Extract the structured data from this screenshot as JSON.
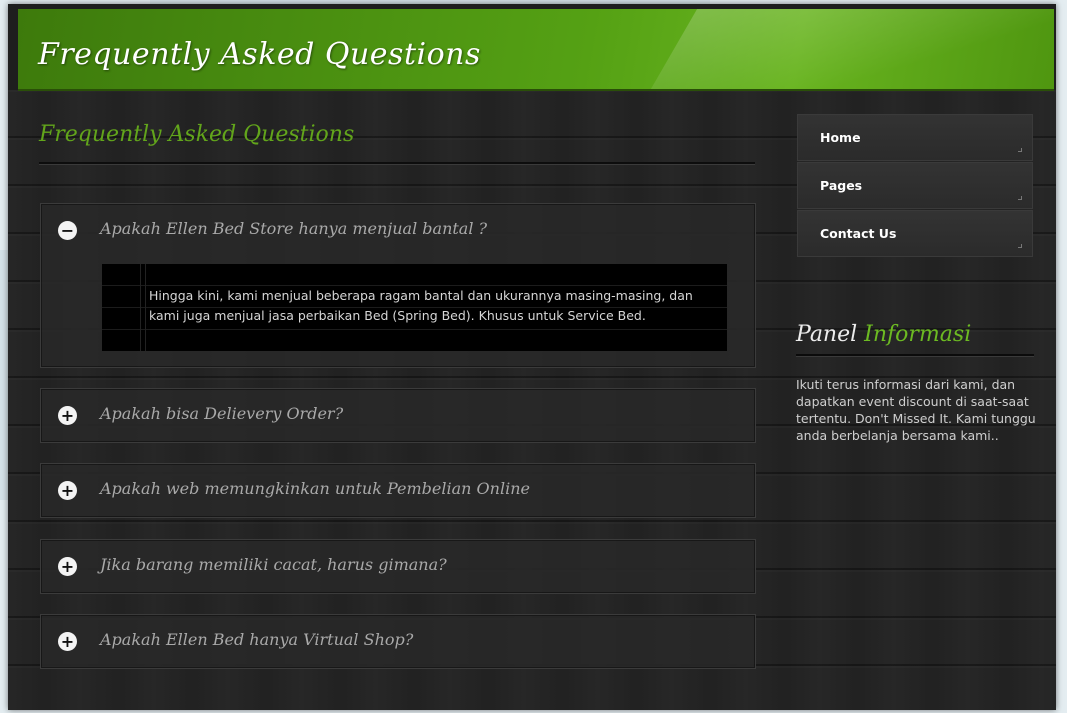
{
  "header": {
    "title": "Frequently Asked Questions"
  },
  "page": {
    "heading": "Frequently Asked Questions"
  },
  "faq": {
    "items": [
      {
        "icon": "minus-circle-icon",
        "symbol": "−",
        "question": "Apakah Ellen Bed Store hanya menjual bantal ?",
        "answer": "Hingga kini, kami menjual beberapa ragam bantal dan ukurannya masing-masing, dan kami juga menjual jasa perbaikan Bed (Spring Bed). Khusus untuk Service Bed.",
        "expanded": true
      },
      {
        "icon": "plus-circle-icon",
        "symbol": "+",
        "question": "Apakah bisa Delievery Order?",
        "expanded": false
      },
      {
        "icon": "plus-circle-icon",
        "symbol": "+",
        "question": "Apakah web memungkinkan untuk Pembelian Online",
        "expanded": false
      },
      {
        "icon": "plus-circle-icon",
        "symbol": "+",
        "question": "Jika barang memiliki cacat, harus gimana?",
        "expanded": false
      },
      {
        "icon": "plus-circle-icon",
        "symbol": "+",
        "question": "Apakah Ellen Bed hanya Virtual Shop?",
        "expanded": false
      }
    ]
  },
  "nav": {
    "items": [
      {
        "label": "Home"
      },
      {
        "label": "Pages"
      },
      {
        "label": "Contact Us"
      }
    ]
  },
  "panel": {
    "title_plain": "Panel",
    "title_accent": "Informasi",
    "text": "Ikuti terus informasi dari kami, dan dapatkan event discount di saat-saat tertentu. Don't Missed It. Kami tunggu anda berbelanja bersama kami.."
  },
  "colors": {
    "accent_green": "#62a51b",
    "header_green": "#55a114",
    "background_dark": "#232323"
  }
}
